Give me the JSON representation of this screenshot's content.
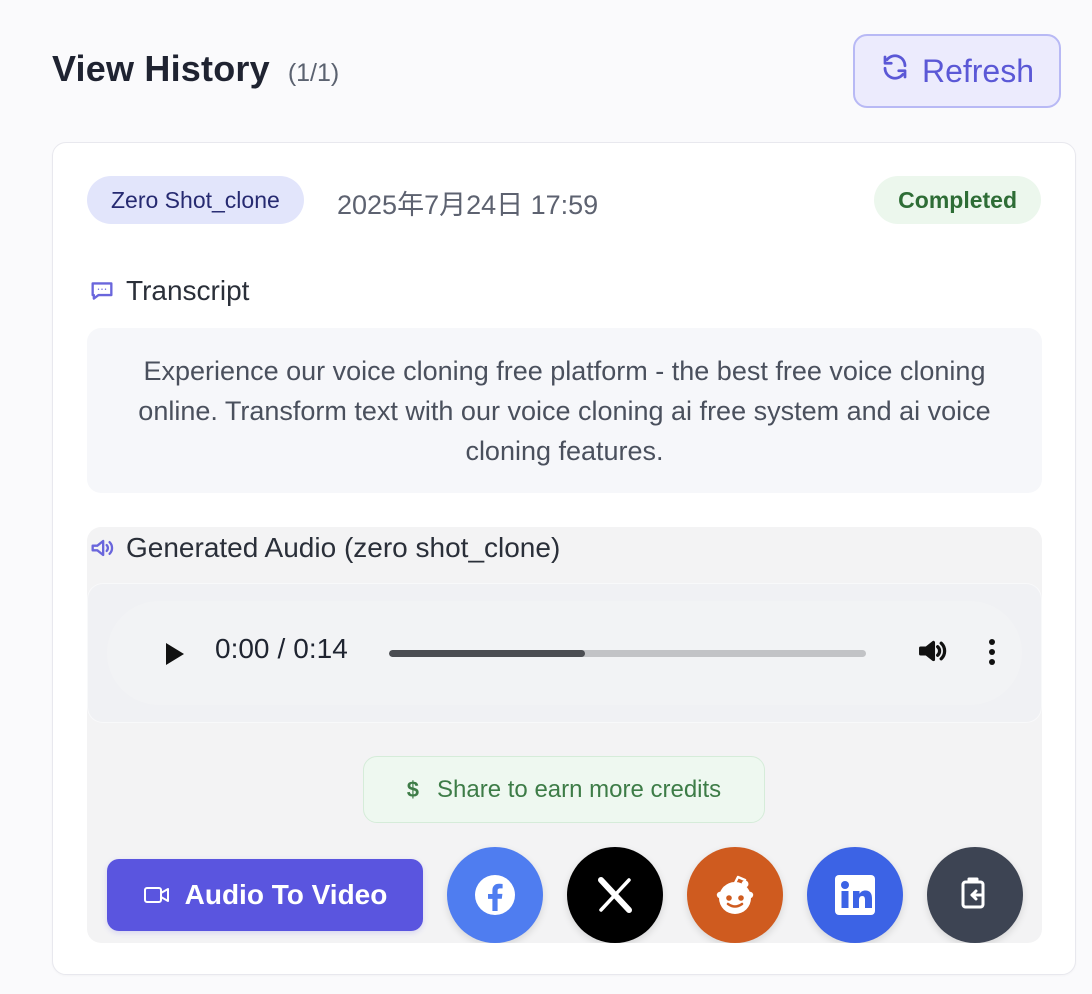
{
  "header": {
    "title": "View History",
    "count": "(1/1)",
    "refresh_label": "Refresh"
  },
  "history_item": {
    "model_tag": "Zero Shot_clone",
    "timestamp": "2025年7月24日 17:59",
    "status": "Completed",
    "transcript": {
      "heading": "Transcript",
      "text": "Experience our voice cloning free platform - the best free voice cloning online. Transform text with our voice cloning ai free system and ai voice cloning features."
    },
    "audio": {
      "heading": "Generated Audio (zero shot_clone)",
      "current_time": "0:00",
      "separator": "/",
      "duration": "0:14",
      "progress_ratio": 0.41
    },
    "share": {
      "credits_icon": "$",
      "credits_label": "Share to earn more credits",
      "audio_to_video_label": "Audio To Video",
      "buttons": [
        "facebook-icon",
        "x-icon",
        "reddit-icon",
        "linkedin-icon",
        "copy-icon"
      ]
    }
  },
  "colors": {
    "page_background": "#fafafc",
    "accent": "#5a55df",
    "refresh_background": "#ecebfd",
    "refresh_border": "#b8b9f5",
    "tag_background": "#e2e5fb",
    "completed_background": "#ecf7ed",
    "completed_text": "#2e6d36",
    "facebook": "#4f7df0",
    "x": "#000000",
    "reddit": "#cf5b1f",
    "linkedin": "#3c63e5",
    "copy": "#3d4453"
  }
}
